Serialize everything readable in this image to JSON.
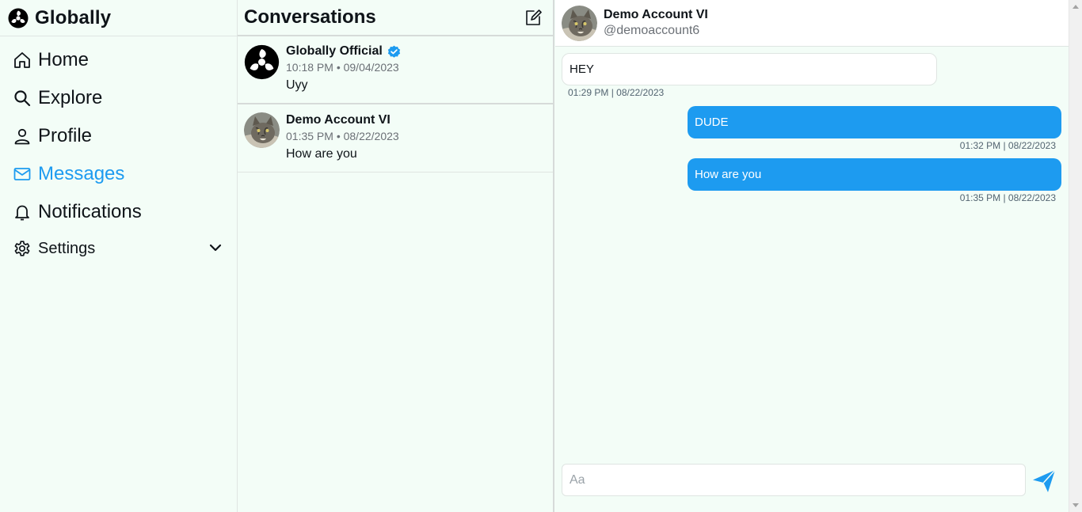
{
  "brand": {
    "name": "Globally"
  },
  "nav": {
    "home": "Home",
    "explore": "Explore",
    "profile": "Profile",
    "messages": "Messages",
    "notifications": "Notifications",
    "settings": "Settings"
  },
  "conversations": {
    "title": "Conversations",
    "items": [
      {
        "name": "Globally Official",
        "time": "10:18 PM • 09/04/2023",
        "preview": "Uyy",
        "verified": true
      },
      {
        "name": "Demo Account VI",
        "time": "01:35 PM • 08/22/2023",
        "preview": "How are you",
        "verified": false
      }
    ]
  },
  "chat": {
    "name": "Demo Account VI",
    "handle": "@demoaccount6",
    "messages": [
      {
        "text": "HEY",
        "time": "01:29 PM | 08/22/2023",
        "direction": "incoming"
      },
      {
        "text": "DUDE",
        "time": "01:32 PM | 08/22/2023",
        "direction": "outgoing"
      },
      {
        "text": "How are you",
        "time": "01:35 PM | 08/22/2023",
        "direction": "outgoing"
      }
    ],
    "composer": {
      "placeholder": "Aa",
      "value": ""
    }
  },
  "colors": {
    "accent": "#1d9bf0",
    "background": "#f3fdf7",
    "verified": "#1d9bf0"
  },
  "icons": {
    "brand": "globe-logo-icon",
    "home": "home-icon",
    "explore": "search-icon",
    "profile": "user-icon",
    "messages": "mail-icon",
    "notifications": "bell-icon",
    "settings": "gear-icon",
    "expand": "chevron-down-icon",
    "compose": "compose-icon",
    "verified": "verified-badge-icon",
    "send": "send-icon"
  }
}
